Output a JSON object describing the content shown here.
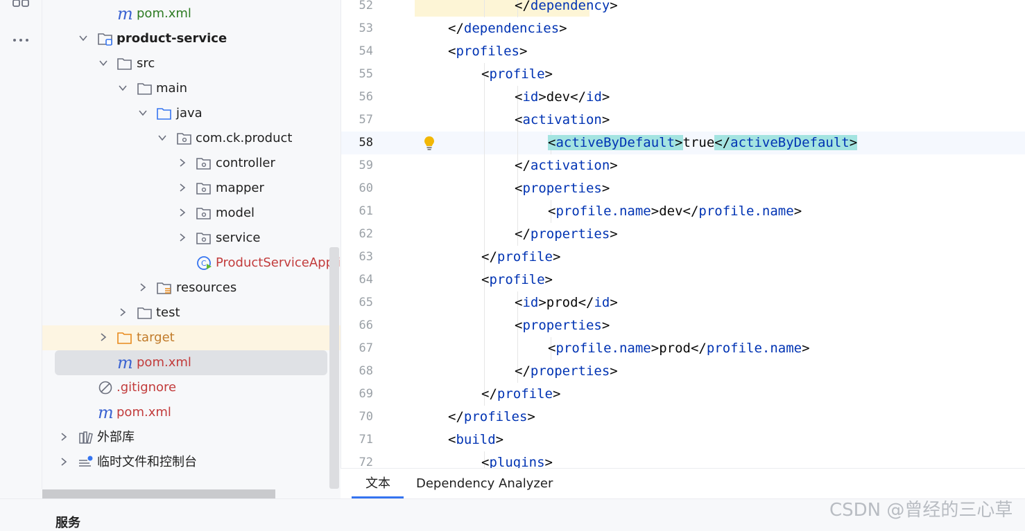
{
  "project_tree": {
    "rows": [
      {
        "label": "pom.xml",
        "icon": "maven-icon"
      },
      {
        "label": "product-service",
        "icon": "module-folder-icon"
      },
      {
        "label": "src",
        "icon": "folder-icon"
      },
      {
        "label": "main",
        "icon": "folder-icon"
      },
      {
        "label": "java",
        "icon": "source-folder-icon"
      },
      {
        "label": "com.ck.product",
        "icon": "package-icon"
      },
      {
        "label": "controller",
        "icon": "package-icon"
      },
      {
        "label": "mapper",
        "icon": "package-icon"
      },
      {
        "label": "model",
        "icon": "package-icon"
      },
      {
        "label": "service",
        "icon": "package-icon"
      },
      {
        "label": "ProductServiceApplic",
        "icon": "spring-boot-class-icon"
      },
      {
        "label": "resources",
        "icon": "resources-folder-icon"
      },
      {
        "label": "test",
        "icon": "folder-icon"
      },
      {
        "label": "target",
        "icon": "excluded-folder-icon"
      },
      {
        "label": "pom.xml",
        "icon": "maven-icon"
      },
      {
        "label": ".gitignore",
        "icon": "ignored-file-icon"
      },
      {
        "label": "pom.xml",
        "icon": "maven-icon"
      },
      {
        "label": "外部库",
        "icon": "library-icon"
      },
      {
        "label": "临时文件和控制台",
        "icon": "scratches-icon"
      }
    ],
    "maven_glyph": "m"
  },
  "editor": {
    "lines": [
      {
        "num": "52",
        "tokens": [
          [
            "p",
            "</"
          ],
          [
            "t",
            "dependency"
          ],
          [
            "p",
            ">"
          ]
        ]
      },
      {
        "num": "53",
        "tokens": [
          [
            "p",
            "</"
          ],
          [
            "t",
            "dependencies"
          ],
          [
            "p",
            ">"
          ]
        ]
      },
      {
        "num": "54",
        "tokens": [
          [
            "p",
            "<"
          ],
          [
            "t",
            "profiles"
          ],
          [
            "p",
            ">"
          ]
        ]
      },
      {
        "num": "55",
        "tokens": [
          [
            "p",
            "<"
          ],
          [
            "t",
            "profile"
          ],
          [
            "p",
            ">"
          ]
        ]
      },
      {
        "num": "56",
        "tokens": [
          [
            "p",
            "<"
          ],
          [
            "t",
            "id"
          ],
          [
            "p",
            ">"
          ],
          [
            "x",
            "dev"
          ],
          [
            "p",
            "</"
          ],
          [
            "t",
            "id"
          ],
          [
            "p",
            ">"
          ]
        ]
      },
      {
        "num": "57",
        "tokens": [
          [
            "p",
            "<"
          ],
          [
            "t",
            "activation"
          ],
          [
            "p",
            ">"
          ]
        ]
      },
      {
        "num": "58",
        "tokens": [
          [
            "mp",
            "<"
          ],
          [
            "mt",
            "activeByDefault"
          ],
          [
            "mp",
            ">"
          ],
          [
            "x",
            "true"
          ],
          [
            "mp",
            "</"
          ],
          [
            "mt",
            "activeByDefault"
          ],
          [
            "mp",
            ">"
          ]
        ]
      },
      {
        "num": "59",
        "tokens": [
          [
            "p",
            "</"
          ],
          [
            "t",
            "activation"
          ],
          [
            "p",
            ">"
          ]
        ]
      },
      {
        "num": "60",
        "tokens": [
          [
            "p",
            "<"
          ],
          [
            "t",
            "properties"
          ],
          [
            "p",
            ">"
          ]
        ]
      },
      {
        "num": "61",
        "tokens": [
          [
            "p",
            "<"
          ],
          [
            "t",
            "profile.name"
          ],
          [
            "p",
            ">"
          ],
          [
            "x",
            "dev"
          ],
          [
            "p",
            "</"
          ],
          [
            "t",
            "profile.name"
          ],
          [
            "p",
            ">"
          ]
        ]
      },
      {
        "num": "62",
        "tokens": [
          [
            "p",
            "</"
          ],
          [
            "t",
            "properties"
          ],
          [
            "p",
            ">"
          ]
        ]
      },
      {
        "num": "63",
        "tokens": [
          [
            "p",
            "</"
          ],
          [
            "t",
            "profile"
          ],
          [
            "p",
            ">"
          ]
        ]
      },
      {
        "num": "64",
        "tokens": [
          [
            "p",
            "<"
          ],
          [
            "t",
            "profile"
          ],
          [
            "p",
            ">"
          ]
        ]
      },
      {
        "num": "65",
        "tokens": [
          [
            "p",
            "<"
          ],
          [
            "t",
            "id"
          ],
          [
            "p",
            ">"
          ],
          [
            "x",
            "prod"
          ],
          [
            "p",
            "</"
          ],
          [
            "t",
            "id"
          ],
          [
            "p",
            ">"
          ]
        ]
      },
      {
        "num": "66",
        "tokens": [
          [
            "p",
            "<"
          ],
          [
            "t",
            "properties"
          ],
          [
            "p",
            ">"
          ]
        ]
      },
      {
        "num": "67",
        "tokens": [
          [
            "p",
            "<"
          ],
          [
            "t",
            "profile.name"
          ],
          [
            "p",
            ">"
          ],
          [
            "x",
            "prod"
          ],
          [
            "p",
            "</"
          ],
          [
            "t",
            "profile.name"
          ],
          [
            "p",
            ">"
          ]
        ]
      },
      {
        "num": "68",
        "tokens": [
          [
            "p",
            "</"
          ],
          [
            "t",
            "properties"
          ],
          [
            "p",
            ">"
          ]
        ]
      },
      {
        "num": "69",
        "tokens": [
          [
            "p",
            "</"
          ],
          [
            "t",
            "profile"
          ],
          [
            "p",
            ">"
          ]
        ]
      },
      {
        "num": "70",
        "tokens": [
          [
            "p",
            "</"
          ],
          [
            "t",
            "profiles"
          ],
          [
            "p",
            ">"
          ]
        ]
      },
      {
        "num": "71",
        "tokens": [
          [
            "p",
            "<"
          ],
          [
            "t",
            "build"
          ],
          [
            "p",
            ">"
          ]
        ]
      },
      {
        "num": "72",
        "tokens": [
          [
            "p",
            "<"
          ],
          [
            "t",
            "plugins"
          ],
          [
            "p",
            ">"
          ]
        ]
      }
    ],
    "current_line": "58"
  },
  "bottom_tabs": {
    "text_tab": "文本",
    "analyzer_tab": "Dependency Analyzer"
  },
  "services_panel": {
    "title": "服务"
  },
  "watermark": "CSDN @曾经的三心草",
  "colors": {
    "tag": "#0033b3",
    "text": "#080808",
    "match_highlight": "#a4e4e1",
    "selection": "#dfe1e5",
    "accent": "#3574f0"
  }
}
